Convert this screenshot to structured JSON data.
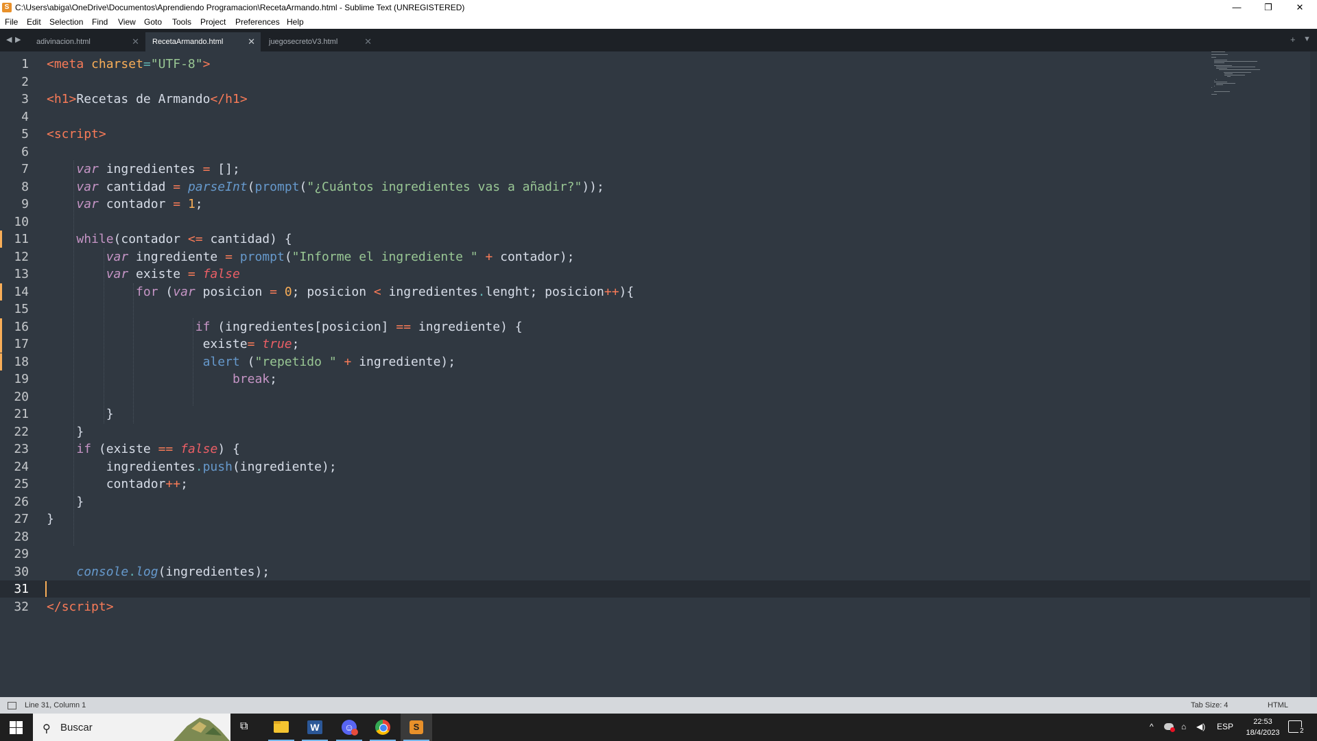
{
  "window": {
    "title": "C:\\Users\\abiga\\OneDrive\\Documentos\\Aprendiendo Programacion\\RecetaArmando.html - Sublime Text (UNREGISTERED)",
    "app_icon": "S",
    "minimize": "—",
    "restore": "❐",
    "close": "✕"
  },
  "menu": [
    "File",
    "Edit",
    "Selection",
    "Find",
    "View",
    "Goto",
    "Tools",
    "Project",
    "Preferences",
    "Help"
  ],
  "tabs": [
    {
      "label": "adivinacion.html",
      "active": false
    },
    {
      "label": "RecetaArmando.html",
      "active": true
    },
    {
      "label": "juegosecretoV3.html",
      "active": false
    }
  ],
  "tab_icons": {
    "nav_left": "◀",
    "nav_right": "▶",
    "close": "✕",
    "new_tab": "+",
    "tab_list": "▼"
  },
  "editor": {
    "current_line": 31,
    "modified_lines": [
      11,
      14,
      16,
      17,
      18
    ],
    "line_numbers": [
      "1",
      "2",
      "3",
      "4",
      "5",
      "6",
      "7",
      "8",
      "9",
      "10",
      "11",
      "12",
      "13",
      "14",
      "15",
      "16",
      "17",
      "18",
      "19",
      "20",
      "21",
      "22",
      "23",
      "24",
      "25",
      "26",
      "27",
      "28",
      "29",
      "30",
      "31",
      "32"
    ],
    "lines": [
      [
        [
          "tag",
          "<"
        ],
        [
          "tag",
          "meta"
        ],
        [
          "p",
          " "
        ],
        [
          "attr",
          "charset"
        ],
        [
          "pun",
          "="
        ],
        [
          "str",
          "\"UTF-8\""
        ],
        [
          "tag",
          ">"
        ]
      ],
      [],
      [
        [
          "tag",
          "<"
        ],
        [
          "tag",
          "h1"
        ],
        [
          "tag",
          ">"
        ],
        [
          "p",
          "Recetas de Armando"
        ],
        [
          "tag",
          "</"
        ],
        [
          "tag",
          "h1"
        ],
        [
          "tag",
          ">"
        ]
      ],
      [],
      [
        [
          "tag",
          "<"
        ],
        [
          "tag",
          "script"
        ],
        [
          "tag",
          ">"
        ]
      ],
      [],
      [
        [
          "p",
          "    "
        ],
        [
          "st",
          "var"
        ],
        [
          "p",
          " ingredientes "
        ],
        [
          "op",
          "="
        ],
        [
          "p",
          " [];"
        ]
      ],
      [
        [
          "p",
          "    "
        ],
        [
          "st",
          "var"
        ],
        [
          "p",
          " cantidad "
        ],
        [
          "op",
          "="
        ],
        [
          "p",
          " "
        ],
        [
          "fi",
          "parseInt"
        ],
        [
          "p",
          "("
        ],
        [
          "fn",
          "prompt"
        ],
        [
          "p",
          "("
        ],
        [
          "str",
          "\"¿Cuántos ingredientes vas a añadir?\""
        ],
        [
          "p",
          "));"
        ]
      ],
      [
        [
          "p",
          "    "
        ],
        [
          "st",
          "var"
        ],
        [
          "p",
          " contador "
        ],
        [
          "op",
          "="
        ],
        [
          "p",
          " "
        ],
        [
          "num",
          "1"
        ],
        [
          "p",
          ";"
        ]
      ],
      [],
      [
        [
          "p",
          "    "
        ],
        [
          "kw",
          "while"
        ],
        [
          "p",
          "(contador "
        ],
        [
          "op",
          "<="
        ],
        [
          "p",
          " cantidad) {"
        ]
      ],
      [
        [
          "p",
          "        "
        ],
        [
          "st",
          "var"
        ],
        [
          "p",
          " ingrediente "
        ],
        [
          "op",
          "="
        ],
        [
          "p",
          " "
        ],
        [
          "fn",
          "prompt"
        ],
        [
          "p",
          "("
        ],
        [
          "str",
          "\"Informe el ingrediente \""
        ],
        [
          "p",
          " "
        ],
        [
          "op",
          "+"
        ],
        [
          "p",
          " contador);"
        ]
      ],
      [
        [
          "p",
          "        "
        ],
        [
          "st",
          "var"
        ],
        [
          "p",
          " existe "
        ],
        [
          "op",
          "="
        ],
        [
          "p",
          " "
        ],
        [
          "bool",
          "false"
        ]
      ],
      [
        [
          "p",
          "            "
        ],
        [
          "kw",
          "for"
        ],
        [
          "p",
          " ("
        ],
        [
          "st",
          "var"
        ],
        [
          "p",
          " posicion "
        ],
        [
          "op",
          "="
        ],
        [
          "p",
          " "
        ],
        [
          "num",
          "0"
        ],
        [
          "p",
          "; posicion "
        ],
        [
          "op",
          "<"
        ],
        [
          "p",
          " ingredientes"
        ],
        [
          "pun",
          "."
        ],
        [
          "p",
          "lenght; posicion"
        ],
        [
          "op",
          "++"
        ],
        [
          "p",
          "){"
        ]
      ],
      [],
      [
        [
          "p",
          "                    "
        ],
        [
          "kw",
          "if"
        ],
        [
          "p",
          " (ingredientes[posicion] "
        ],
        [
          "op",
          "=="
        ],
        [
          "p",
          " ingrediente) {"
        ]
      ],
      [
        [
          "p",
          "                     existe"
        ],
        [
          "op",
          "="
        ],
        [
          "p",
          " "
        ],
        [
          "bool",
          "true"
        ],
        [
          "p",
          ";"
        ]
      ],
      [
        [
          "p",
          "                     "
        ],
        [
          "fn",
          "alert"
        ],
        [
          "p",
          " ("
        ],
        [
          "str",
          "\"repetido \""
        ],
        [
          "p",
          " "
        ],
        [
          "op",
          "+"
        ],
        [
          "p",
          " ingrediente);"
        ]
      ],
      [
        [
          "p",
          "                         "
        ],
        [
          "kw",
          "break"
        ],
        [
          "p",
          ";"
        ]
      ],
      [],
      [
        [
          "p",
          "        }"
        ]
      ],
      [
        [
          "p",
          "    }"
        ]
      ],
      [
        [
          "p",
          "    "
        ],
        [
          "kw",
          "if"
        ],
        [
          "p",
          " (existe "
        ],
        [
          "op",
          "=="
        ],
        [
          "p",
          " "
        ],
        [
          "bool",
          "false"
        ],
        [
          "p",
          ") {"
        ]
      ],
      [
        [
          "p",
          "        ingredientes"
        ],
        [
          "pun",
          "."
        ],
        [
          "fn",
          "push"
        ],
        [
          "p",
          "(ingrediente);"
        ]
      ],
      [
        [
          "p",
          "        contador"
        ],
        [
          "op",
          "++"
        ],
        [
          "p",
          ";"
        ]
      ],
      [
        [
          "p",
          "    }"
        ]
      ],
      [
        [
          "p",
          "}"
        ]
      ],
      [],
      [],
      [
        [
          "p",
          "    "
        ],
        [
          "fi",
          "console"
        ],
        [
          "pun",
          "."
        ],
        [
          "fi",
          "log"
        ],
        [
          "p",
          "(ingredientes);"
        ]
      ],
      [],
      [
        [
          "tag",
          "</"
        ],
        [
          "tag",
          "script"
        ],
        [
          "tag",
          ">"
        ]
      ]
    ]
  },
  "status": {
    "position": "Line 31, Column 1",
    "tab_size": "Tab Size: 4",
    "syntax": "HTML"
  },
  "taskbar": {
    "search_placeholder": "Buscar",
    "search_icon": "⚲",
    "task_view_icon": "⧉",
    "apps": [
      {
        "name": "file-explorer",
        "color": "#f4c430"
      },
      {
        "name": "word",
        "color": "#2b5797",
        "letter": "W"
      },
      {
        "name": "discord",
        "color": "#5865f2",
        "letter": "☺"
      },
      {
        "name": "chrome",
        "color": "#34a853"
      },
      {
        "name": "sublime-text",
        "color": "#e8902a",
        "letter": "S",
        "active": true
      }
    ],
    "tray": {
      "chevron": "^",
      "network": "⌂",
      "volume": "◀)",
      "language": "ESP"
    },
    "time": "22:53",
    "date": "18/4/2023",
    "notifications": "2"
  }
}
